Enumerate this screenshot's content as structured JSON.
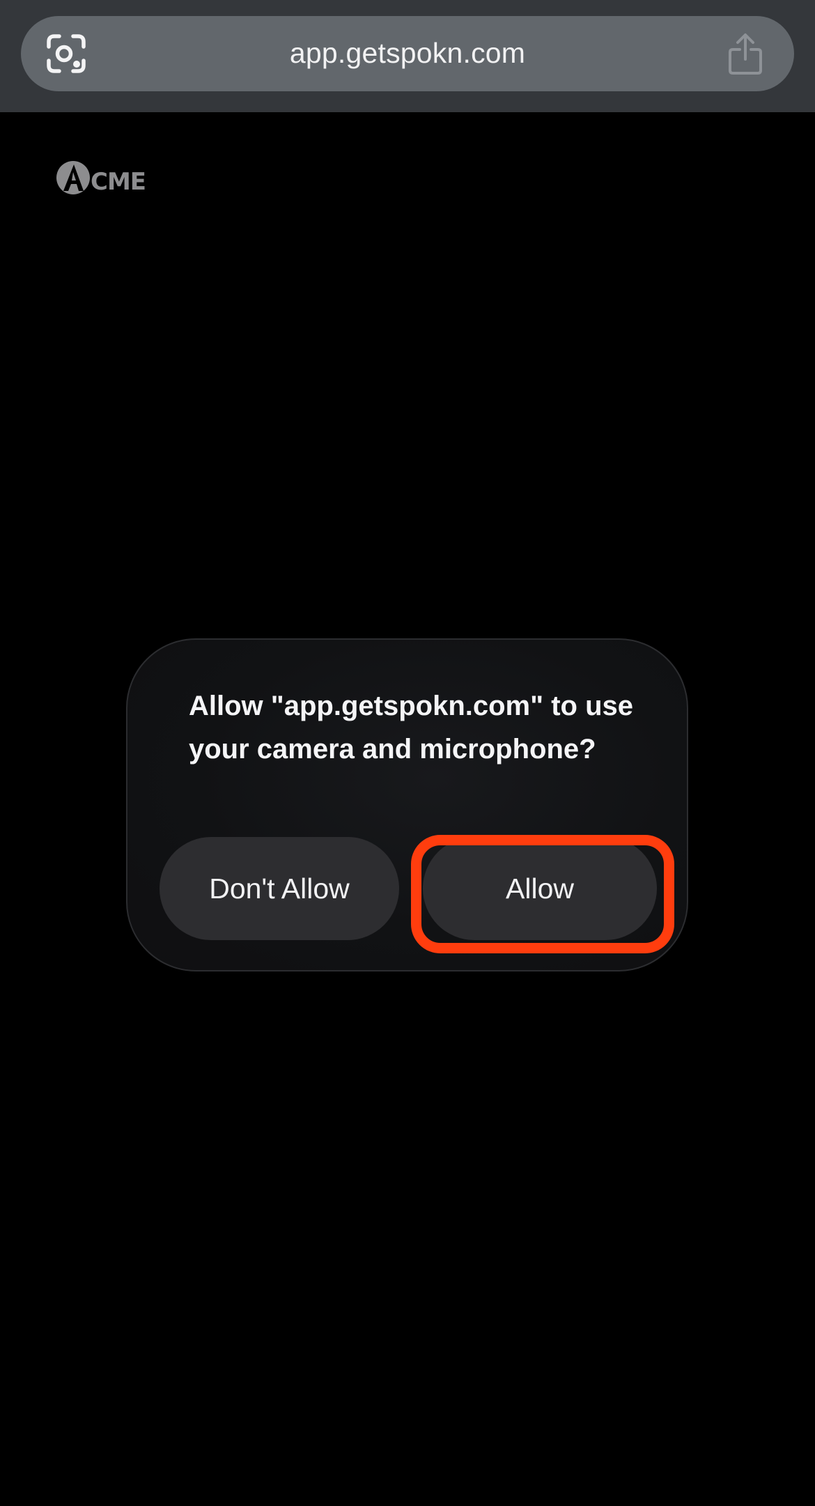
{
  "browser": {
    "url": "app.getspokn.com",
    "left_icon": "camera-scan-icon",
    "right_icon": "share-icon"
  },
  "page": {
    "logo_text": "ACME"
  },
  "dialog": {
    "message": "Allow \"app.getspokn.com\" to use your camera and microphone?",
    "deny_label": "Don't Allow",
    "allow_label": "Allow",
    "highlight_color": "#ff3d0e"
  },
  "colors": {
    "browser_bar": "#34373b",
    "address_pill": "#62676c",
    "page_background": "#000000",
    "dialog_background": "#111214",
    "button_background": "#2d2d30"
  }
}
